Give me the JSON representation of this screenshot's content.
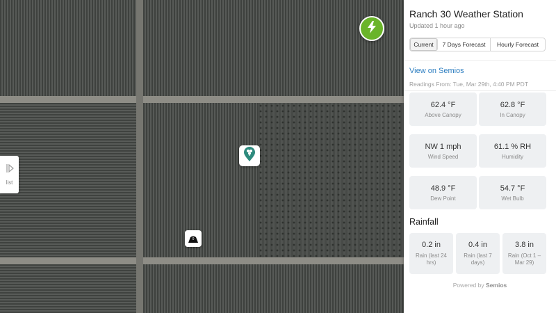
{
  "map": {
    "list_tab_label": "list",
    "icons": {
      "list_toggle": "sidebar-toggle-icon",
      "bolt": "lightning-bolt-icon",
      "station": "weather-station-icon",
      "trap": "trap-icon"
    },
    "trap_marker_label": "0"
  },
  "panel": {
    "title": "Ranch 30 Weather Station",
    "updated": "Updated 1 hour ago",
    "tabs": [
      {
        "label": "Current",
        "active": true
      },
      {
        "label": "7 Days Forecast",
        "active": false
      },
      {
        "label": "Hourly Forecast",
        "active": false
      }
    ],
    "link": "View on Semios",
    "readings_from": "Readings From: Tue, Mar 29th, 4:40 PM PDT",
    "metrics": [
      {
        "value": "62.4 °F",
        "caption": "Above Canopy"
      },
      {
        "value": "62.8 °F",
        "caption": "In Canopy"
      },
      {
        "value": "NW 1 mph",
        "caption": "Wind Speed"
      },
      {
        "value": "61.1 % RH",
        "caption": "Humidity"
      },
      {
        "value": "48.9 °F",
        "caption": "Dew Point"
      },
      {
        "value": "54.7 °F",
        "caption": "Wet Bulb"
      }
    ],
    "rainfall": {
      "heading": "Rainfall",
      "items": [
        {
          "value": "0.2 in",
          "caption": "Rain (last 24 hrs)"
        },
        {
          "value": "0.4 in",
          "caption": "Rain (last 7 days)"
        },
        {
          "value": "3.8 in",
          "caption": "Rain (Oct 1 – Mar 29)"
        }
      ]
    },
    "powered_by_prefix": "Powered by",
    "powered_by_brand": "Semios"
  },
  "colors": {
    "accent_link": "#2f7fc1",
    "bolt_green": "#6ab42a",
    "station_teal": "#2e8b7e"
  }
}
